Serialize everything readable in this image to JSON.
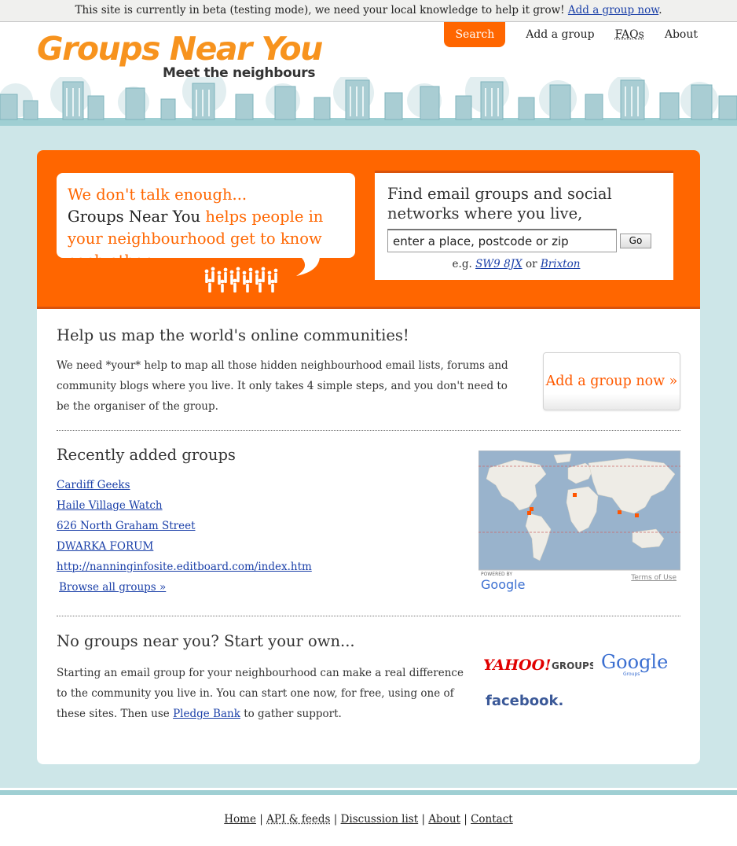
{
  "beta_bar": {
    "text": "This site is currently in beta (testing mode), we need your local knowledge to help it grow!",
    "link": "Add a group now",
    "end": "."
  },
  "header": {
    "logo_title": "Groups Near You",
    "logo_tagline": "Meet the neighbours",
    "nav": [
      "Search",
      "Add a group",
      "FAQs",
      "About"
    ]
  },
  "hero": {
    "line1": "We don't talk enough...",
    "brand": "Groups Near You",
    "rest": "helps people in your neighbourhood get to know each other"
  },
  "find": {
    "heading": "Find email groups and social networks where you live,",
    "input_value": "enter a place, postcode or zip",
    "go_label": "Go",
    "eg_prefix": "e.g.",
    "eg_link1": "SW9 8JX",
    "eg_or": "or",
    "eg_link2": "Brixton"
  },
  "help": {
    "heading": "Help us map the world's online communities!",
    "text": "We need *your* help to map all those hidden neighbourhood email lists, forums and community blogs where you live. It only takes 4 simple steps, and you don't need to be the organiser of the group.",
    "button": "Add a group now »"
  },
  "recent": {
    "heading": "Recently added groups",
    "items": [
      "Cardiff Geeks",
      "Haile Village Watch",
      "626 North Graham Street",
      "DWARKA FORUM",
      "http://nanninginfosite.editboard.com/index.htm"
    ],
    "browse": "Browse all groups »",
    "map": {
      "powered_by": "POWERED BY",
      "google": "Google",
      "terms": "Terms of Use"
    }
  },
  "own": {
    "heading": "No groups near you? Start your own...",
    "text_before": "Starting an email group for your neighbourhood can make a real difference to the community you live in. You can start one now, for free, using one of these sites. Then use",
    "link": "Pledge Bank",
    "text_after": "to gather support.",
    "logos": {
      "yahoo": "YAHOO!",
      "yahoo_groups": "GROUPS",
      "google": "Google",
      "google_groups": "Groups",
      "facebook": "facebook."
    }
  },
  "footer": {
    "links": [
      "Home",
      "API & feeds",
      "Discussion list",
      "About",
      "Contact"
    ]
  },
  "colors": {
    "accent": "#ff6600",
    "page_bg": "#cde6e8",
    "link": "#1a3fa8"
  }
}
